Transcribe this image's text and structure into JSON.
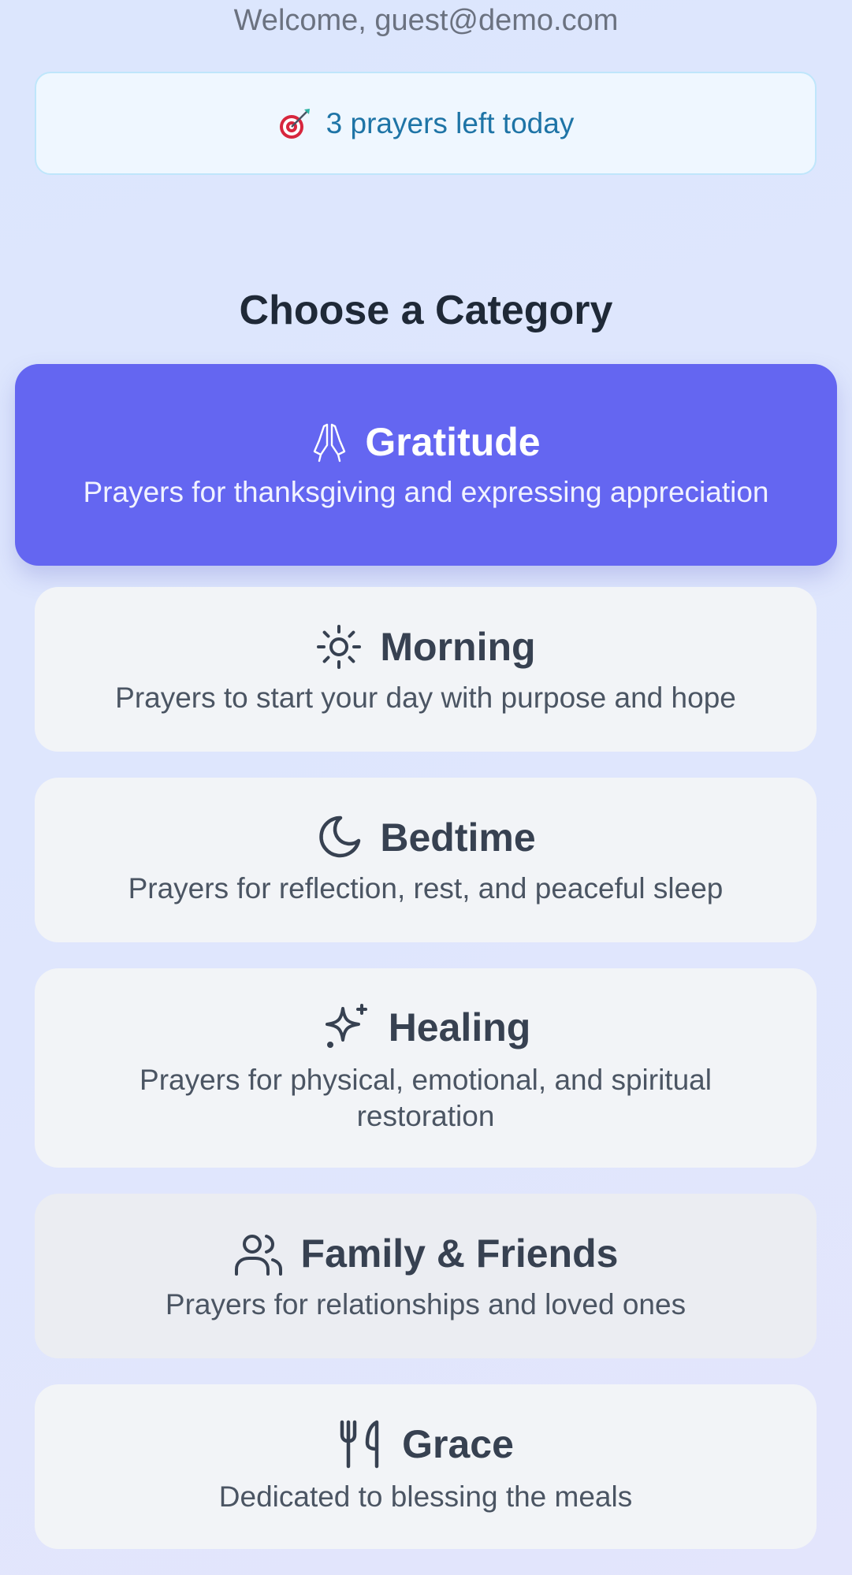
{
  "header": {
    "welcome": "Welcome, guest@demo.com"
  },
  "quota": {
    "icon": "target-icon",
    "text": "3 prayers left today"
  },
  "section": {
    "title": "Choose a Category"
  },
  "categories": [
    {
      "title": "Gratitude",
      "description": "Prayers for thanksgiving and expressing appreciation",
      "icon": "praying-hands-icon",
      "selected": true
    },
    {
      "title": "Morning",
      "description": "Prayers to start your day with purpose and hope",
      "icon": "sun-icon",
      "selected": false
    },
    {
      "title": "Bedtime",
      "description": "Prayers for reflection, rest, and peaceful sleep",
      "icon": "moon-icon",
      "selected": false
    },
    {
      "title": "Healing",
      "description": "Prayers for physical, emotional, and spiritual restoration",
      "icon": "sparkles-icon",
      "selected": false
    },
    {
      "title": "Family & Friends",
      "description": "Prayers for relationships and loved ones",
      "icon": "users-icon",
      "selected": false
    },
    {
      "title": "Grace",
      "description": "Dedicated to blessing the meals",
      "icon": "utensils-icon",
      "selected": false
    }
  ],
  "colors": {
    "accent": "#6466f1",
    "card_bg": "#f2f4f7",
    "quota_text": "#1e74a6"
  }
}
